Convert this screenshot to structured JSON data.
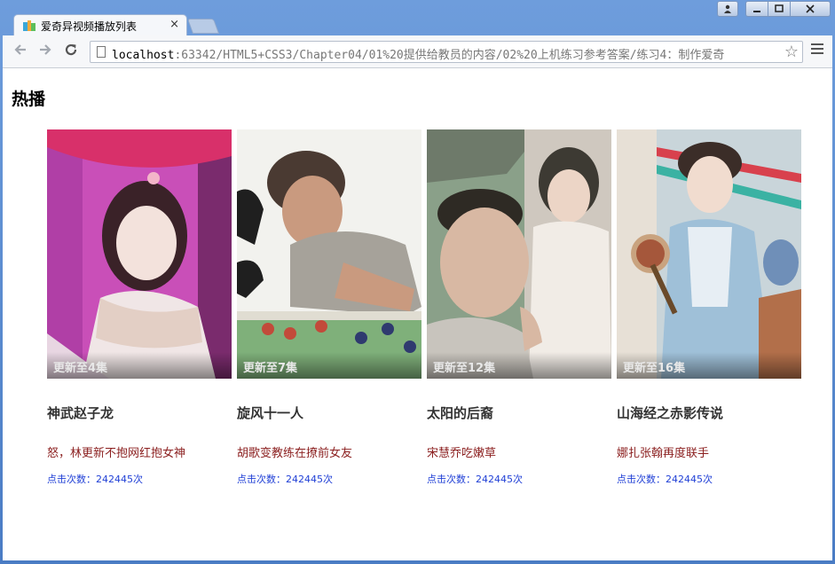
{
  "browser": {
    "tab_title": "爱奇异视频播放列表",
    "tab_close": "×",
    "url_host": "localhost",
    "url_rest": ":63342/HTML5+CSS3/Chapter04/01%20提供给教员的内容/02%20上机练习参考答案/练习4：制作爱奇",
    "icons": {
      "back": "arrow-left-icon",
      "forward": "arrow-right-icon",
      "reload": "reload-icon",
      "star": "star-icon",
      "menu": "hamburger-icon"
    },
    "window_buttons": {
      "user": "user-icon",
      "minimize": "minimize-icon",
      "maximize": "maximize-icon",
      "close": "close-icon"
    }
  },
  "page": {
    "heading": "热播",
    "cards": [
      {
        "episode": "更新至4集",
        "title": "神武赵子龙",
        "desc": "怒，林更新不抱网红抱女神",
        "clicks": "点击次数：242445次",
        "palette": [
          "#c94fb8",
          "#e9d7dc",
          "#7a2b6d",
          "#f3e8e8"
        ]
      },
      {
        "episode": "更新至7集",
        "title": "旋风十一人",
        "desc": "胡歌变教练在撩前女友",
        "clicks": "点击次数：242445次",
        "palette": [
          "#f2f2ee",
          "#b9b4aa",
          "#4a3a32",
          "#7fb07a"
        ]
      },
      {
        "episode": "更新至12集",
        "title": "太阳的后裔",
        "desc": "宋慧乔吃嫩草",
        "clicks": "点击次数：242445次",
        "palette": [
          "#8aa089",
          "#e9e3dc",
          "#3d3a33",
          "#d8b8a3"
        ]
      },
      {
        "episode": "更新至16集",
        "title": "山海经之赤影传说",
        "desc": "娜扎张翰再度联手",
        "clicks": "点击次数：242445次",
        "palette": [
          "#9fc0d8",
          "#e7e0d6",
          "#3b2d28",
          "#c9a37f"
        ]
      }
    ]
  }
}
